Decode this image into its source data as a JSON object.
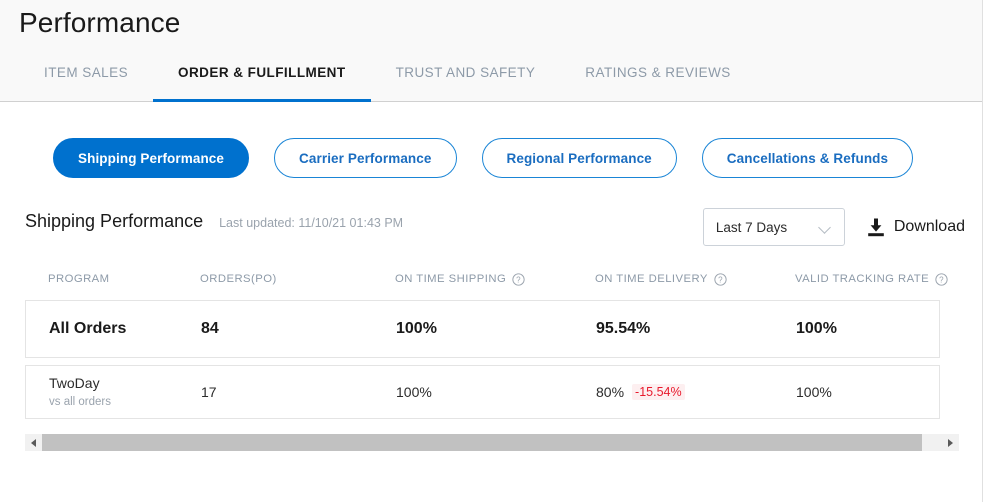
{
  "header": {
    "title": "Performance",
    "tabs": [
      {
        "label": "ITEM SALES",
        "active": false
      },
      {
        "label": "ORDER & FULFILLMENT",
        "active": true
      },
      {
        "label": "TRUST AND SAFETY",
        "active": false
      },
      {
        "label": "RATINGS & REVIEWS",
        "active": false
      }
    ]
  },
  "pills": [
    {
      "label": "Shipping Performance",
      "selected": true
    },
    {
      "label": "Carrier Performance",
      "selected": false
    },
    {
      "label": "Regional Performance",
      "selected": false
    },
    {
      "label": "Cancellations & Refunds",
      "selected": false
    }
  ],
  "section": {
    "title": "Shipping Performance",
    "last_updated_label": "Last updated:",
    "last_updated_value": "11/10/21 01:43 PM",
    "range_value": "Last 7 Days",
    "download_label": "Download",
    "chevron_icon": "chevron-down-icon",
    "download_icon": "download-icon"
  },
  "table": {
    "columns": [
      {
        "label": "PROGRAM",
        "help": false
      },
      {
        "label": "ORDERS(PO)",
        "help": false
      },
      {
        "label": "ON TIME SHIPPING",
        "help": true
      },
      {
        "label": "ON TIME DELIVERY",
        "help": true
      },
      {
        "label": "VALID TRACKING RATE",
        "help": true
      }
    ],
    "help_icon": "help-circle-icon",
    "rows": [
      {
        "program": "All Orders",
        "program_sub": "",
        "orders": "84",
        "on_time_shipping": "100%",
        "on_time_delivery": "95.54%",
        "on_time_delivery_delta": "",
        "valid_tracking_rate": "100%"
      },
      {
        "program": "TwoDay",
        "program_sub": "vs all orders",
        "orders": "17",
        "on_time_shipping": "100%",
        "on_time_delivery": "80%",
        "on_time_delivery_delta": "-15.54%",
        "valid_tracking_rate": "100%"
      }
    ]
  },
  "scrollbar": {
    "left_arrow_icon": "triangle-left-icon",
    "right_arrow_icon": "triangle-right-icon"
  },
  "colors": {
    "accent": "#0071ce",
    "pill_border": "#1a85d6",
    "negative": "#e8192c",
    "negative_bg": "#fdeff0",
    "muted": "#8d9aa8"
  }
}
